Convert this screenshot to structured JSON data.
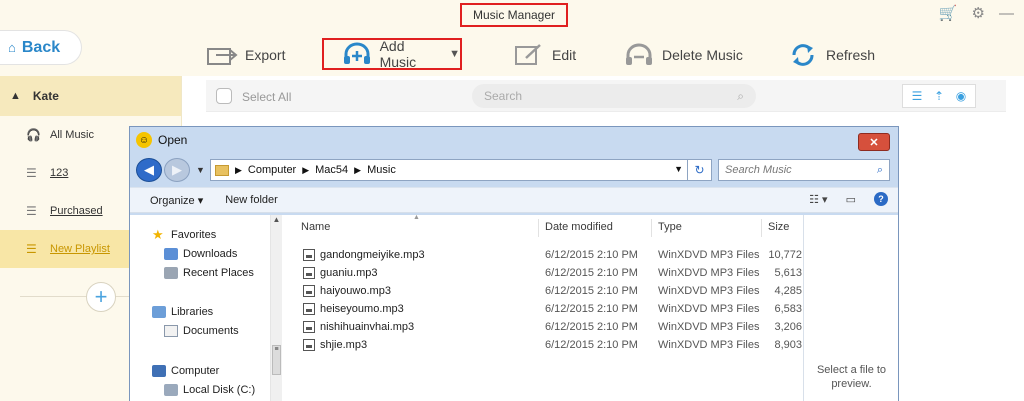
{
  "app": {
    "title": "Music Manager",
    "back_label": "Back"
  },
  "toolbar": {
    "export": "Export",
    "add_music": "Add Music",
    "edit": "Edit",
    "delete_music": "Delete Music",
    "refresh": "Refresh"
  },
  "sidebar": {
    "device": "Kate",
    "items": [
      {
        "label": "All Music",
        "icon": "headphones-icon"
      },
      {
        "label": "123",
        "icon": "playlist-icon"
      },
      {
        "label": "Purchased",
        "icon": "playlist-icon"
      },
      {
        "label": "New Playlist",
        "icon": "playlist-icon"
      }
    ]
  },
  "listbar": {
    "select_all": "Select All",
    "search_placeholder": "Search"
  },
  "dialog": {
    "title": "Open",
    "path": [
      "Computer",
      "Mac54",
      "Music"
    ],
    "search_placeholder": "Search Music",
    "organize": "Organize ▾",
    "new_folder": "New folder",
    "nav": {
      "favorites": "Favorites",
      "downloads": "Downloads",
      "recent_places": "Recent Places",
      "libraries": "Libraries",
      "documents": "Documents",
      "computer": "Computer",
      "local_disk": "Local Disk (C:)"
    },
    "columns": {
      "name": "Name",
      "date": "Date modified",
      "type": "Type",
      "size": "Size"
    },
    "files": [
      {
        "name": "gandongmeiyike.mp3",
        "date": "6/12/2015 2:10 PM",
        "type": "WinXDVD MP3 Files",
        "size": "10,772"
      },
      {
        "name": "guaniu.mp3",
        "date": "6/12/2015 2:10 PM",
        "type": "WinXDVD MP3 Files",
        "size": "5,613"
      },
      {
        "name": "haiyouwo.mp3",
        "date": "6/12/2015 2:10 PM",
        "type": "WinXDVD MP3 Files",
        "size": "4,285"
      },
      {
        "name": "heiseyoumo.mp3",
        "date": "6/12/2015 2:10 PM",
        "type": "WinXDVD MP3 Files",
        "size": "6,583"
      },
      {
        "name": "nishihuainvhai.mp3",
        "date": "6/12/2015 2:10 PM",
        "type": "WinXDVD MP3 Files",
        "size": "3,206"
      },
      {
        "name": "shjie.mp3",
        "date": "6/12/2015 2:10 PM",
        "type": "WinXDVD MP3 Files",
        "size": "8,903"
      }
    ],
    "preview_msg": "Select a file to preview."
  },
  "colors": {
    "accent": "#2a87c9",
    "highlight": "#e02020",
    "sidebar_active": "#f8e6a6"
  }
}
